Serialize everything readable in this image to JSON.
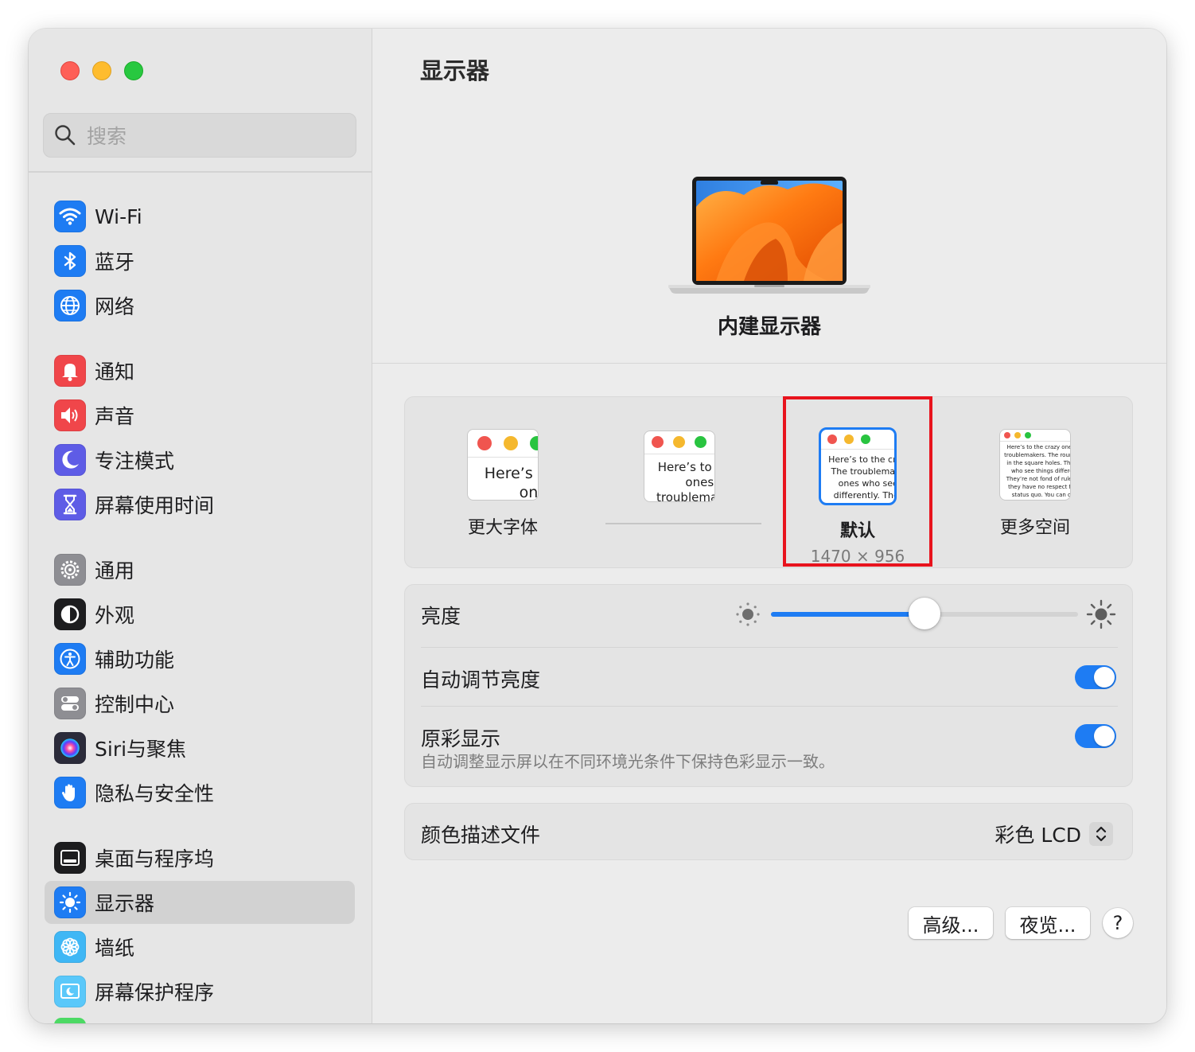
{
  "sidebar": {
    "search": {
      "placeholder": "搜索"
    },
    "items": [
      {
        "label": "Wi-Fi",
        "icon": "wifi-icon",
        "color": "#1e7cf3"
      },
      {
        "label": "蓝牙",
        "icon": "bluetooth-icon",
        "color": "#1e7cf3"
      },
      {
        "label": "网络",
        "icon": "globe-icon",
        "color": "#1e7cf3"
      },
      {
        "label": "通知",
        "icon": "bell-icon",
        "color": "#f0464a"
      },
      {
        "label": "声音",
        "icon": "speaker-icon",
        "color": "#f0464a"
      },
      {
        "label": "专注模式",
        "icon": "moon-icon",
        "color": "#5e5ce6"
      },
      {
        "label": "屏幕使用时间",
        "icon": "hourglass-icon",
        "color": "#5e5ce6"
      },
      {
        "label": "通用",
        "icon": "gear-icon",
        "color": "#8e8e93"
      },
      {
        "label": "外观",
        "icon": "appearance-icon",
        "color": "#1d1d1f"
      },
      {
        "label": "辅助功能",
        "icon": "accessibility-icon",
        "color": "#1e7cf3"
      },
      {
        "label": "控制中心",
        "icon": "toggles-icon",
        "color": "#8e8e93"
      },
      {
        "label": "Siri与聚焦",
        "icon": "siri-icon",
        "color": "#2b2b3a"
      },
      {
        "label": "隐私与安全性",
        "icon": "hand-icon",
        "color": "#1e7cf3"
      },
      {
        "label": "桌面与程序坞",
        "icon": "dock-icon",
        "color": "#1d1d1f"
      },
      {
        "label": "显示器",
        "icon": "sun-icon",
        "color": "#1e7cf3",
        "selected": true
      },
      {
        "label": "墙纸",
        "icon": "flower-icon",
        "color": "#3fb7f5"
      },
      {
        "label": "屏幕保护程序",
        "icon": "screensaver-icon",
        "color": "#5ac8fa"
      }
    ]
  },
  "main": {
    "title": "显示器",
    "display_name": "内建显示器",
    "resolution": {
      "options": [
        {
          "label": "更大字体",
          "sub": "",
          "thumb_text": "Here’s to the crazy ones. The troublemakers."
        },
        {
          "label": "",
          "sub": "",
          "thumb_text": "Here’s to the crazy ones. The troublemakers. The ones who"
        },
        {
          "label": "默认",
          "sub": "1470 × 956",
          "selected": true,
          "thumb_text": "Here’s to the crazy ones. The troublemakers. The ones who see things differently. They’re not fond of rules. And they"
        },
        {
          "label": "更多空间",
          "sub": "",
          "thumb_text": "Here’s to the crazy ones. The troublemakers. The round pegs in the square holes. The ones who see things differently. They’re not fond of rules. And they have no respect for the status quo. You can quote them, disagree with them, glorify or vilify them. About the only thing you can’t do is ignore them. Because they change things."
        }
      ]
    },
    "brightness": {
      "label": "亮度",
      "value": 0.5
    },
    "auto_brightness": {
      "label": "自动调节亮度",
      "on": true
    },
    "true_tone": {
      "label": "原彩显示",
      "description": "自动调整显示屏以在不同环境光条件下保持色彩显示一致。",
      "on": true
    },
    "color_profile": {
      "label": "颜色描述文件",
      "value": "彩色 LCD"
    },
    "buttons": {
      "advanced": "高级...",
      "night_shift": "夜览...",
      "help": "?"
    }
  },
  "colors": {
    "accent": "#1e7cf3",
    "highlight": "#e8131d"
  }
}
